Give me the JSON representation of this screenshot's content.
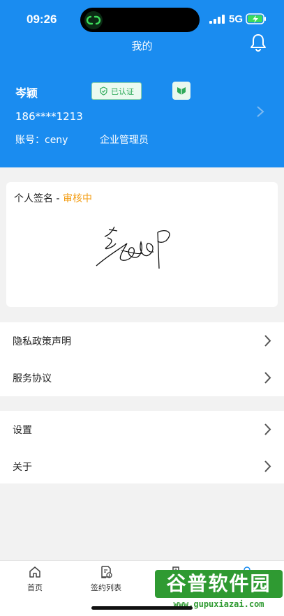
{
  "status_bar": {
    "time": "09:26",
    "network": "5G"
  },
  "header": {
    "title": "我的"
  },
  "profile": {
    "name": "岑颖",
    "verified_label": "已认证",
    "phone": "186****1213",
    "account": "账号：ceny",
    "role": "企业管理员"
  },
  "signature": {
    "title": "个人签名 - ",
    "status": "审核中"
  },
  "menu": {
    "group1": [
      {
        "label": "隐私政策声明"
      },
      {
        "label": "服务协议"
      }
    ],
    "group2": [
      {
        "label": "设置"
      },
      {
        "label": "关于"
      }
    ]
  },
  "bottom_nav": {
    "items": [
      {
        "label": "首页"
      },
      {
        "label": "签约列表"
      },
      {
        "label": ""
      },
      {
        "label": ""
      }
    ]
  },
  "watermark": {
    "main": "谷普软件园",
    "url": "www.gupuxiazai.com"
  },
  "colors": {
    "brand_blue": "#1a8cf0",
    "verified_green": "#2eaa5a",
    "status_orange": "#f39c12"
  }
}
